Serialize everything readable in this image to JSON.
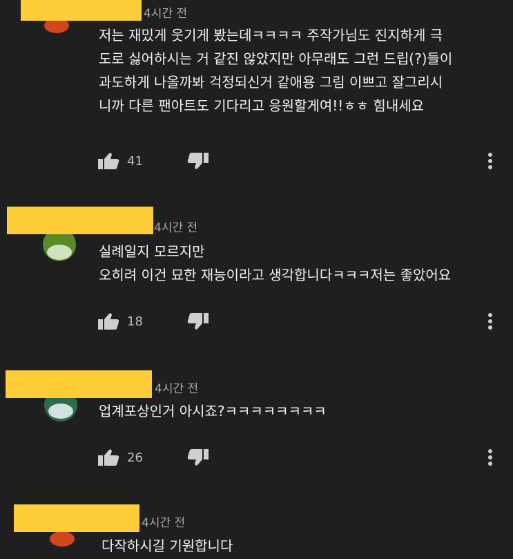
{
  "comments": [
    {
      "time": "4시간 전",
      "text": "저는 재밌게 웃기게 봤는데ㅋㅋㅋㅋ 주작가님도 진지하게 극\n도로 싫어하시는 거 같진 않았지만 아무래도 그런 드립(?)들이\n과도하게 나올까봐 걱정되신거 같애용 그림 이쁘고 잘그리시\n니까 다른 팬아트도 기다리고 응원할게여!!ㅎㅎ 힘내세요",
      "likes": "41",
      "avatar_color": "#d0461d"
    },
    {
      "time": "4시간 전",
      "text": "실례일지 모르지만\n오히려 이건 묘한 재능이라고 생각합니다ㅋㅋㅋ저는 좋았어요",
      "likes": "18",
      "avatar_color": "#5a8a2a"
    },
    {
      "time": "4시간 전",
      "text": "업계포상인거 아시죠?ㅋㅋㅋㅋㅋㅋㅋㅋ",
      "likes": "26",
      "avatar_color": "#2e6b4a"
    },
    {
      "time": "4시간 전",
      "text": "다작하시길 기원합니다",
      "avatar_color": "#d0461d"
    }
  ],
  "colors": {
    "background": "#1f1f1f",
    "redaction": "#ffcd37",
    "meta_text": "#aaaaaa"
  },
  "icons": [
    "thumb-up-icon",
    "thumb-down-icon",
    "more-vert-icon"
  ]
}
